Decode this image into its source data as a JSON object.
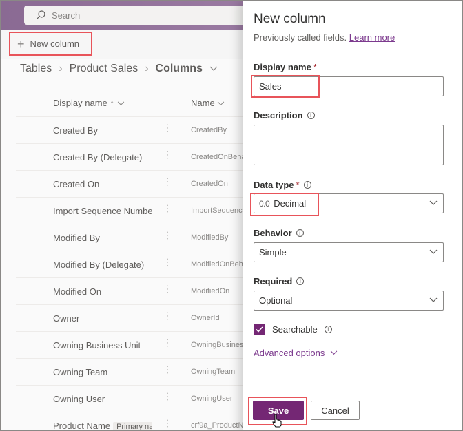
{
  "search": {
    "placeholder": "Search"
  },
  "toolbar": {
    "new_column_label": "New column"
  },
  "breadcrumb": {
    "items": [
      "Tables",
      "Product Sales",
      "Columns"
    ]
  },
  "table": {
    "headers": {
      "display_name": "Display name",
      "name": "Name"
    },
    "rows": [
      {
        "display_name": "Created By",
        "name": "CreatedBy"
      },
      {
        "display_name": "Created By (Delegate)",
        "name": "CreatedOnBeha"
      },
      {
        "display_name": "Created On",
        "name": "CreatedOn"
      },
      {
        "display_name": "Import Sequence Number",
        "name": "ImportSequence"
      },
      {
        "display_name": "Modified By",
        "name": "ModifiedBy"
      },
      {
        "display_name": "Modified By (Delegate)",
        "name": "ModifiedOnBeh"
      },
      {
        "display_name": "Modified On",
        "name": "ModifiedOn"
      },
      {
        "display_name": "Owner",
        "name": "OwnerId"
      },
      {
        "display_name": "Owning Business Unit",
        "name": "OwningBusiness"
      },
      {
        "display_name": "Owning Team",
        "name": "OwningTeam"
      },
      {
        "display_name": "Owning User",
        "name": "OwningUser"
      },
      {
        "display_name": "Product Name",
        "badge": "Primary nar",
        "name": "crf9a_ProductN"
      }
    ]
  },
  "panel": {
    "title": "New column",
    "subtitle": "Previously called fields.",
    "learn_more": "Learn more",
    "display_name": {
      "label": "Display name",
      "required": "*",
      "value": "Sales"
    },
    "description": {
      "label": "Description",
      "value": ""
    },
    "data_type": {
      "label": "Data type",
      "required": "*",
      "icon_text": "0.0",
      "value": "Decimal"
    },
    "behavior": {
      "label": "Behavior",
      "value": "Simple"
    },
    "required_field": {
      "label": "Required",
      "value": "Optional"
    },
    "searchable": {
      "label": "Searchable",
      "checked": true
    },
    "advanced_options": "Advanced options",
    "save_label": "Save",
    "cancel_label": "Cancel"
  },
  "colors": {
    "accent": "#742774",
    "highlight": "#e8545a",
    "link": "#7c3a8e"
  }
}
